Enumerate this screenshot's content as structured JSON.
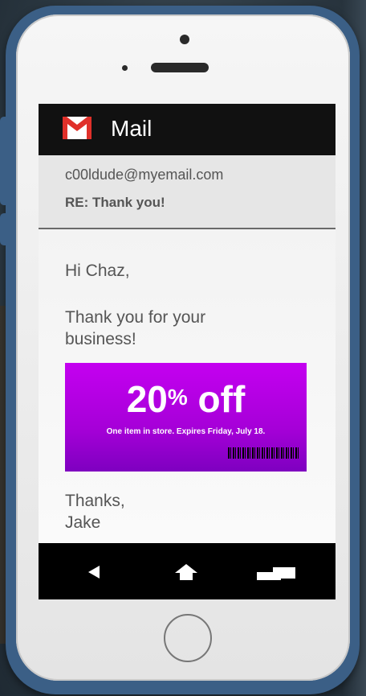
{
  "app": {
    "title": "Mail"
  },
  "email": {
    "sender": "c00ldude@myemail.com",
    "subject": "RE: Thank you!",
    "greeting": "Hi Chaz,",
    "body": "Thank you for your business!",
    "signoff_line1": "Thanks,",
    "signoff_line2": "Jake"
  },
  "coupon": {
    "amount": "20",
    "percent_sign": "%",
    "off_label": " off",
    "details": "One item in store. Expires Friday, July 18.",
    "background_color": "#b100e4"
  },
  "colors": {
    "phone_frame": "#3b5f86",
    "gmail_red": "#e0302a",
    "app_bar": "#111111"
  },
  "icons": {
    "app": "gmail-icon",
    "nav": [
      "back-icon",
      "home-icon",
      "recents-icon"
    ]
  }
}
